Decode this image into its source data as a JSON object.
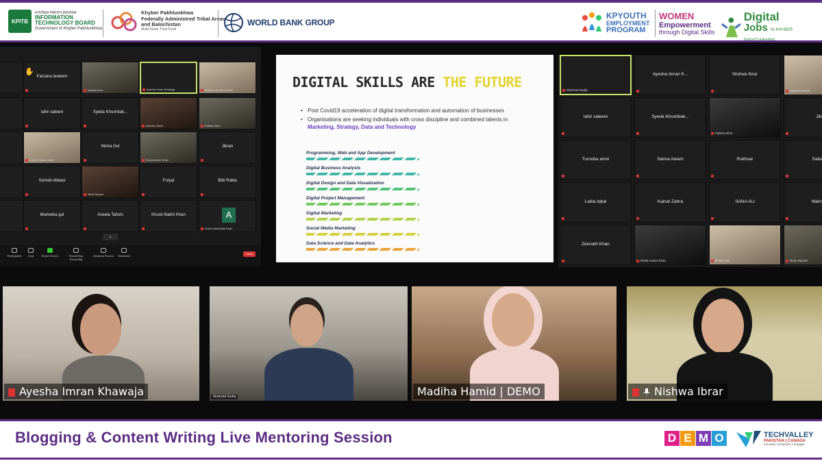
{
  "header": {
    "kpitb": {
      "mark": "KPITB",
      "line1": "KHYBER PAKHTUNKHWA",
      "line2": "INFORMATION",
      "line3": "TECHNOLOGY BOARD",
      "line4": "Government of Khyber Pakhtunkhwa"
    },
    "fata": {
      "line1": "Khyber Pakhtunkhwa",
      "line2": "Federally Administred Tribal Areas",
      "line3": "and Balochistan",
      "line4": "Multi-Donor Trust Fund"
    },
    "worldbank": "WORLD BANK GROUP",
    "kpyouth": {
      "line1": "KPYOUTH",
      "line2": "EMPLOYMENT",
      "line3": "PROGRAM"
    },
    "women": {
      "line1": "WOMEN",
      "line2": "Empowerment",
      "line3": "through Digital Skills"
    },
    "digitaljobs": {
      "line1": "Digital",
      "line2": "Jobs",
      "line2_small": "IN KHYBER PAKHTUNKHWA"
    }
  },
  "zoom_left": {
    "tiles": [
      {
        "name": "Farzana tasleem",
        "foot": ""
      },
      {
        "name": "",
        "foot": "Nishwa Ibrar"
      },
      {
        "name": "",
        "foot": "Ayesha Imran Khawaja"
      },
      {
        "name": "",
        "foot": "Madiha Hamid | DEMO"
      },
      {
        "name": "tahir saleem",
        "foot": ""
      },
      {
        "name": "Syeda Khushbak...",
        "foot": ""
      },
      {
        "name": "",
        "foot": "Ayesha_Saed"
      },
      {
        "name": "",
        "foot": "Fatima Hifza"
      },
      {
        "name": "",
        "foot": "Huma Farman Jabin"
      },
      {
        "name": "Nimra Gul",
        "foot": ""
      },
      {
        "name": "",
        "foot": "Khola Anwar Khan"
      },
      {
        "name": "Jibran",
        "foot": ""
      },
      {
        "name": "Somah Abbasi",
        "foot": ""
      },
      {
        "name": "",
        "foot": "Rose Rachel"
      },
      {
        "name": "Furyal",
        "foot": ""
      },
      {
        "name": "Bibi Rabia",
        "foot": ""
      },
      {
        "name": "Muneeba gul",
        "foot": ""
      },
      {
        "name": "Aneela Tahsin",
        "foot": ""
      },
      {
        "name": "Khush Bakht Khan",
        "foot": ""
      },
      {
        "name": "",
        "foot": "Sumul Samiullah Khan"
      }
    ],
    "avatar_letter": "A",
    "toolbar": [
      "Participants",
      "Chat",
      "Share Screen",
      "Pause/Stop Recording",
      "Breakout Rooms",
      "Reactions"
    ],
    "leave": "Leave"
  },
  "slide": {
    "title_part1": "DIGITAL SKILLS ARE",
    "title_part2": "THE FUTURE",
    "bullet1": "Post Covid19 acceleration of digital transformation and automation of businesses",
    "bullet2_a": "Organisations are seeking individuals with cross discipline and combined talents in",
    "bullet2_b": "Marketing, Strategy, Data and Technology",
    "skills": [
      {
        "label": "Programming, Web and App Development",
        "color": "#3fb6a8"
      },
      {
        "label": "Digital Business Analysts",
        "color": "#3fb6a8"
      },
      {
        "label": "Digital Design and Data Visualization",
        "color": "#4ec27a"
      },
      {
        "label": "Digital Project Management",
        "color": "#6ec85a"
      },
      {
        "label": "Digital Marketing",
        "color": "#b2d24a"
      },
      {
        "label": "Social Media Marketing",
        "color": "#d6cf3e"
      },
      {
        "label": "Data Science and Data Analytics",
        "color": "#e9a23a"
      }
    ]
  },
  "zoom_right": {
    "tiles": [
      {
        "name": "",
        "foot": "Shehzad Sadiq"
      },
      {
        "name": "Ayesha Imran K...",
        "foot": ""
      },
      {
        "name": "Nishwa Ibrar",
        "foot": ""
      },
      {
        "name": "",
        "foot": "Madiha Hamid"
      },
      {
        "name": "tahir saleem",
        "foot": ""
      },
      {
        "name": "Syeda Khushbak...",
        "foot": ""
      },
      {
        "name": "",
        "foot": "Fatima Hifza"
      },
      {
        "name": "Jibr",
        "foot": ""
      },
      {
        "name": "Turooba amin",
        "foot": ""
      },
      {
        "name": "Salma Aleem",
        "foot": ""
      },
      {
        "name": "Rukhsar",
        "foot": ""
      },
      {
        "name": "Saba R",
        "foot": ""
      },
      {
        "name": "Laiba Iqbal",
        "foot": ""
      },
      {
        "name": "Kainat Zahra",
        "foot": ""
      },
      {
        "name": "SANA ALI",
        "foot": ""
      },
      {
        "name": "Mahrish",
        "foot": ""
      },
      {
        "name": "Zeenath Khan",
        "foot": ""
      },
      {
        "name": "",
        "foot": "Khola Anwar Khan"
      },
      {
        "name": "",
        "foot": "Dolha Fazi"
      },
      {
        "name": "",
        "foot": "Rose Rachel"
      }
    ]
  },
  "cams": [
    {
      "caption": "Ayesha Imran Khawaja"
    },
    {
      "caption": "Shehzad Sadiq"
    },
    {
      "caption": "Madiha Hamid | DEMO"
    },
    {
      "caption": "Nishwa Ibrar"
    }
  ],
  "footer": {
    "session_title": "Blogging & Content Writing Live Mentoring Session",
    "demo_letters": [
      "D",
      "E",
      "M",
      "O"
    ],
    "demo_colors": [
      "#e0218a",
      "#f39c12",
      "#7b3fb5",
      "#27a0d8"
    ],
    "techvalley": {
      "line1": "TECHVALLEY",
      "line2": "PAKISTAN | CANADA",
      "line3": "Innovate | Empower | Engage"
    }
  }
}
